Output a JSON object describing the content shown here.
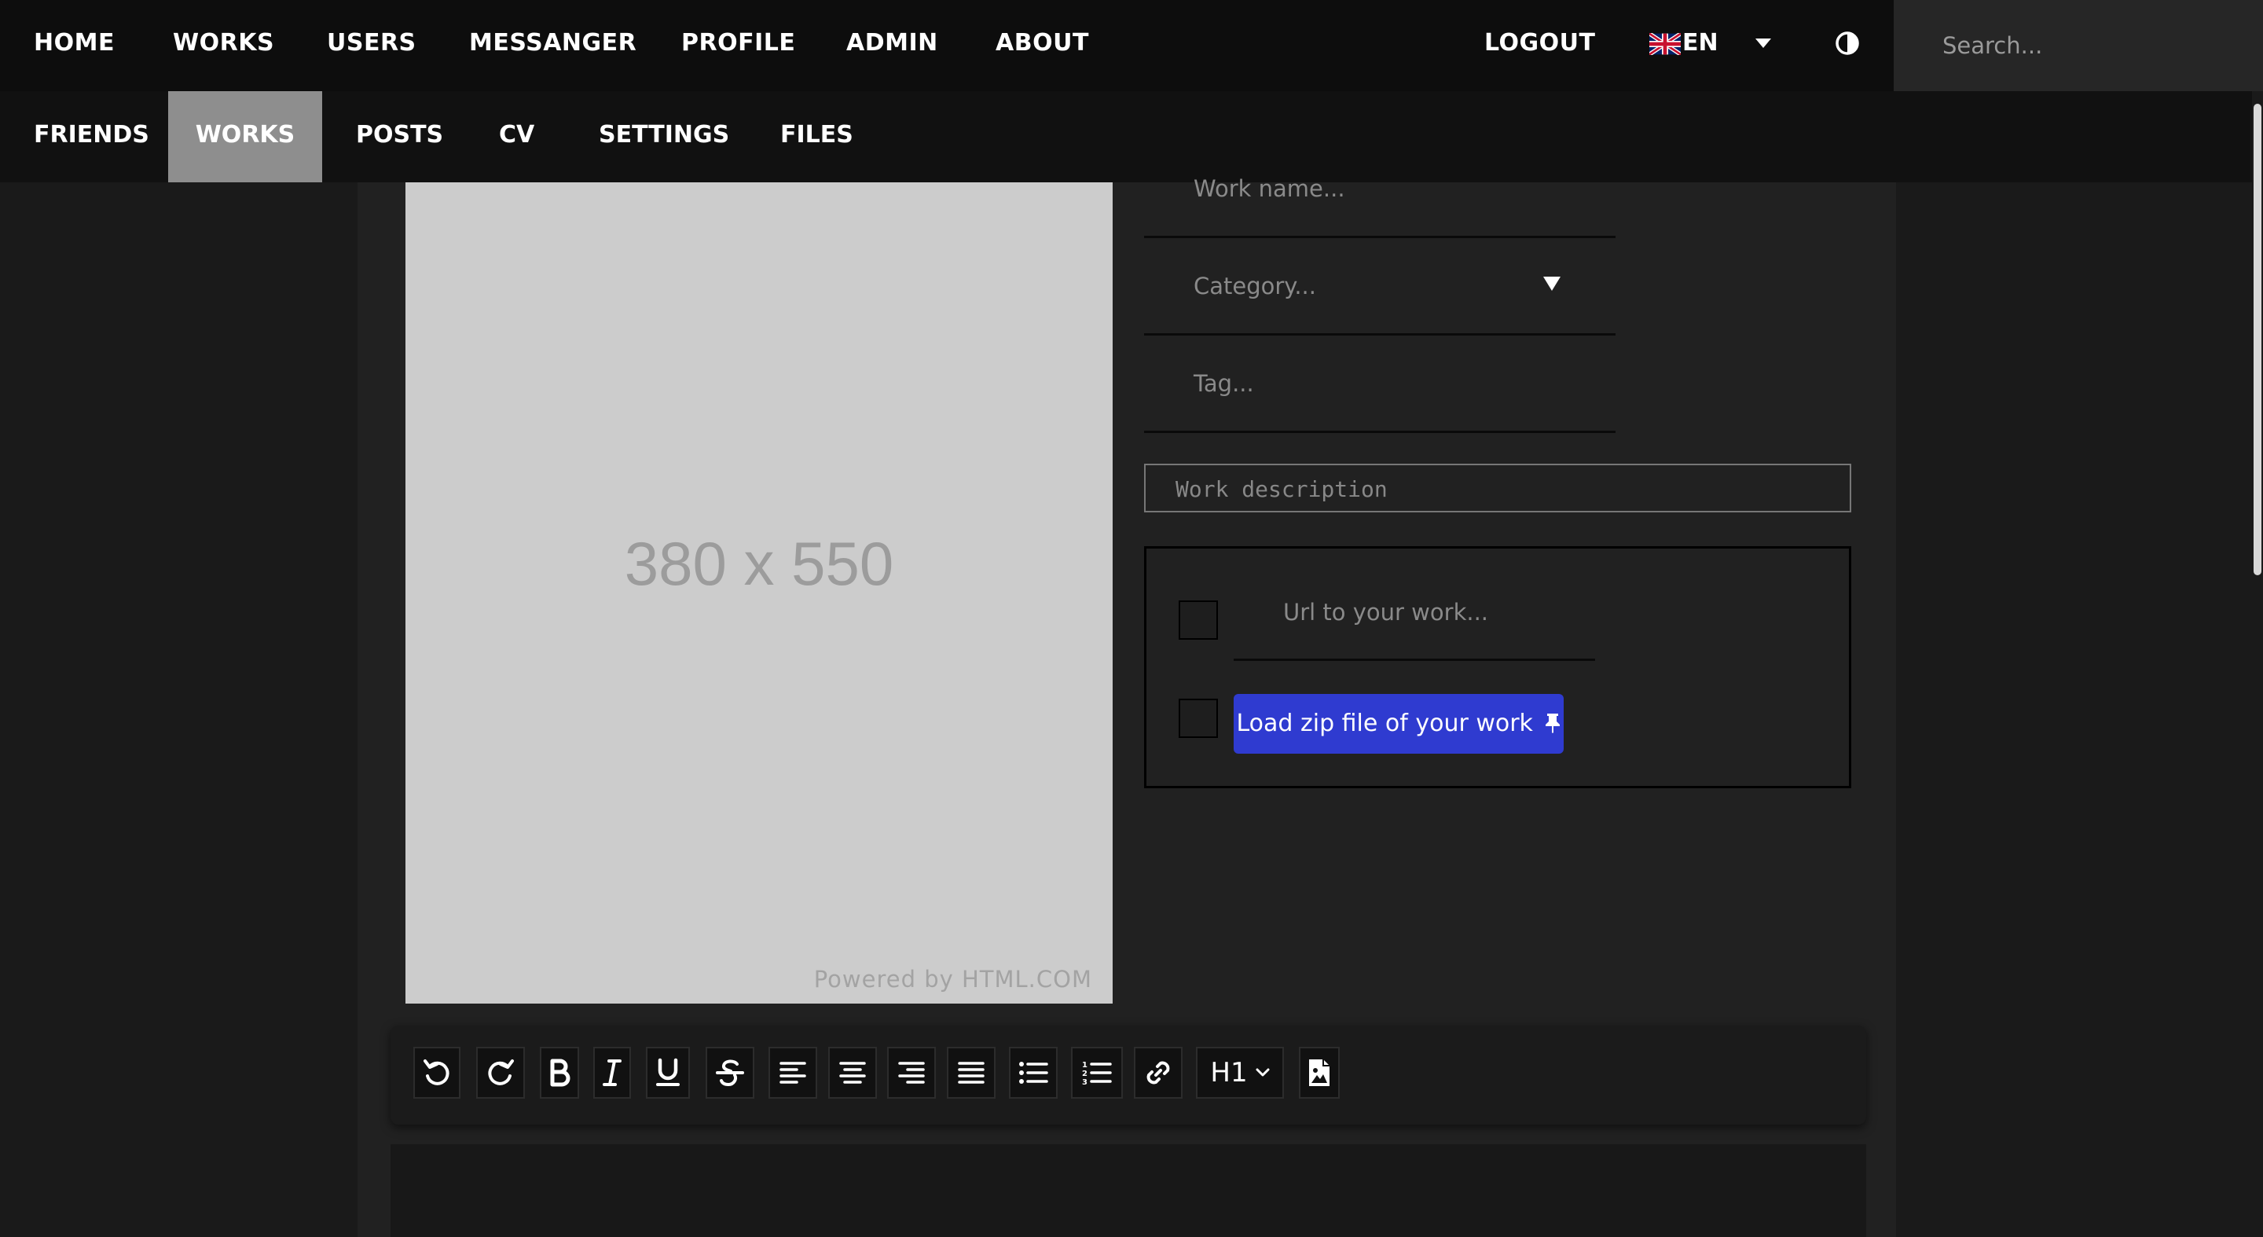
{
  "nav": {
    "home": "HOME",
    "works": "WORKS",
    "users": "USERS",
    "messanger": "MESSANGER",
    "profile": "PROFILE",
    "admin": "ADMIN",
    "about": "ABOUT",
    "logout": "LOGOUT",
    "language": "EN",
    "search_placeholder": "Search..."
  },
  "subnav": {
    "friends": "FRIENDS",
    "works": "WORKS",
    "posts": "POSTS",
    "cv": "CV",
    "settings": "SETTINGS",
    "files": "FILES",
    "active": "WORKS"
  },
  "image_placeholder": {
    "dimensions": "380 x 550",
    "powered_by": "Powered by HTML.COM"
  },
  "form": {
    "work_name_placeholder": "Work name...",
    "category_placeholder": "Category...",
    "tag_placeholder": "Tag...",
    "description_placeholder": "Work description",
    "url_placeholder": "Url to your work...",
    "zip_button": "Load zip file of your work"
  },
  "toolbar": {
    "heading_select": "H1",
    "buttons": [
      "undo-icon",
      "redo-icon",
      "bold-icon",
      "italic-icon",
      "underline-icon",
      "strikethrough-icon",
      "align-left-icon",
      "align-center-icon",
      "align-right-icon",
      "align-justify-icon",
      "bullet-list-icon",
      "numbered-list-icon",
      "link-icon",
      "heading-select",
      "insert-image-icon"
    ]
  },
  "colors": {
    "nav_bg": "#0d0d0d",
    "subnav_active_bg": "#8e8e8e",
    "accent_button": "#2f3bd0",
    "content_bg": "#212121"
  }
}
